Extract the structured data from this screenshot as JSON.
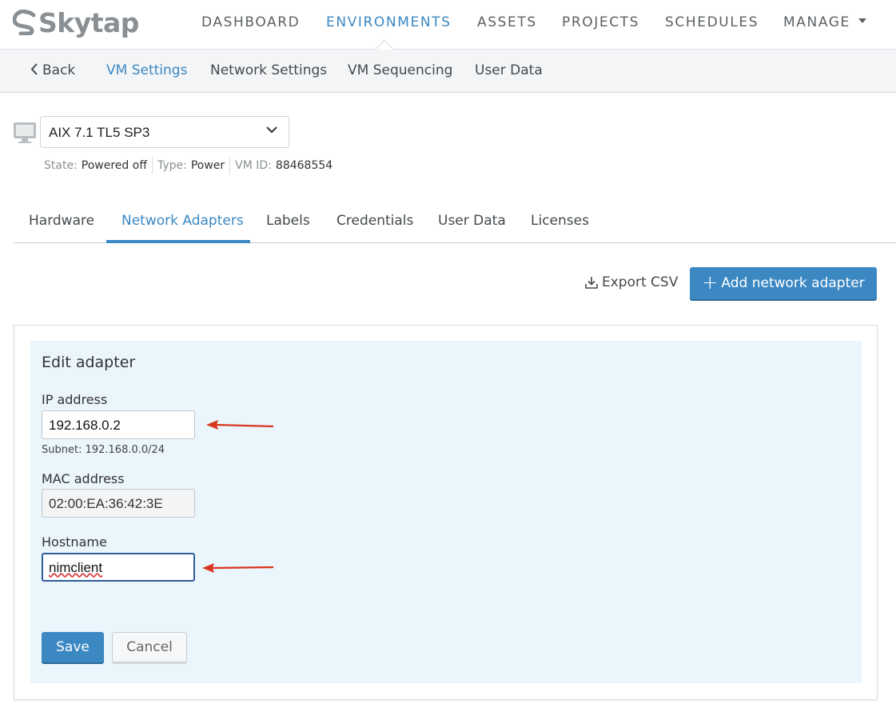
{
  "brand": {
    "name": "Skytap"
  },
  "topnav": {
    "items": [
      "DASHBOARD",
      "ENVIRONMENTS",
      "ASSETS",
      "PROJECTS",
      "SCHEDULES",
      "MANAGE"
    ],
    "active": "ENVIRONMENTS"
  },
  "subnav": {
    "back_label": "Back",
    "items": [
      "VM Settings",
      "Network Settings",
      "VM Sequencing",
      "User Data"
    ],
    "active": "VM Settings"
  },
  "vm": {
    "selected": "AIX 7.1 TL5 SP3",
    "state_label": "State:",
    "state_value": "Powered off",
    "type_label": "Type:",
    "type_value": "Power",
    "id_label": "VM ID:",
    "id_value": "88468554"
  },
  "tabs": {
    "items": [
      "Hardware",
      "Network Adapters",
      "Labels",
      "Credentials",
      "User Data",
      "Licenses"
    ],
    "active": "Network Adapters"
  },
  "actions": {
    "export_label": "Export CSV",
    "add_label": "Add network adapter"
  },
  "edit_adapter": {
    "title": "Edit adapter",
    "ip_label": "IP address",
    "ip_value": "192.168.0.2",
    "subnet_hint": "Subnet: 192.168.0.0/24",
    "mac_label": "MAC address",
    "mac_value": "02:00:EA:36:42:3E",
    "hostname_label": "Hostname",
    "hostname_value": "nimclient",
    "save_label": "Save",
    "cancel_label": "Cancel"
  },
  "colors": {
    "accent": "#3b88c3",
    "panel_bg": "#eaf5fc",
    "annotation_arrow": "#d9361f"
  },
  "icons": [
    "skytap-logo-icon",
    "chevron-left-icon",
    "monitor-icon",
    "chevron-down-icon",
    "download-icon",
    "plus-icon",
    "red-arrow-annotation"
  ]
}
